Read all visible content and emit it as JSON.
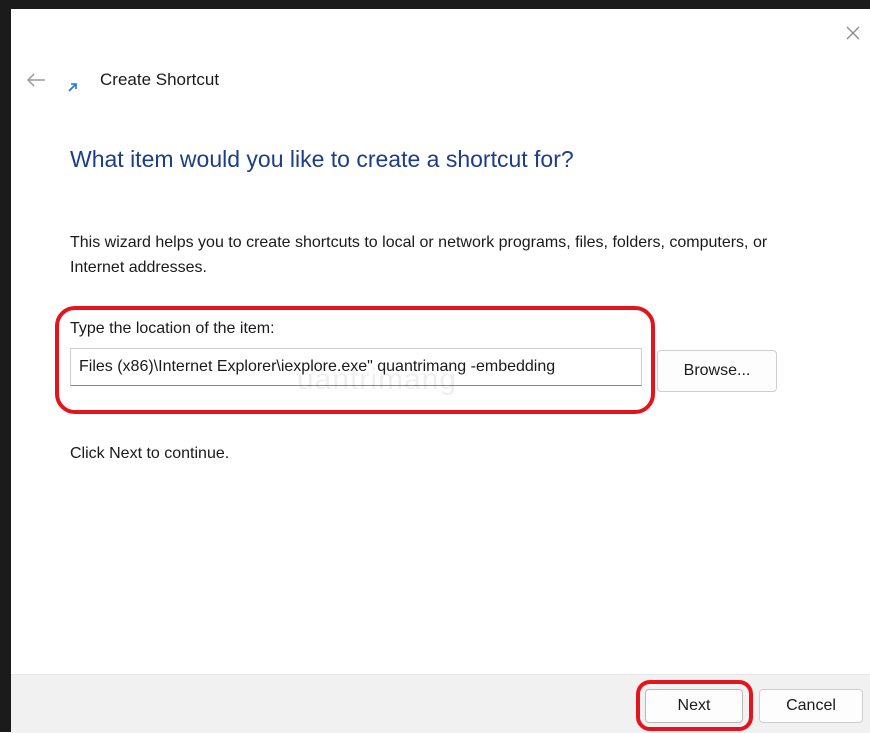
{
  "window": {
    "title": "Create Shortcut",
    "back_icon": "arrow-left-icon",
    "close_icon": "close-icon",
    "shortcut_icon": "shortcut-arrow-icon"
  },
  "main": {
    "heading": "What item would you like to create a shortcut for?",
    "description": "This wizard helps you to create shortcuts to local or network programs, files, folders, computers, or Internet addresses.",
    "location_label": "Type the location of the item:",
    "location_value": "Files (x86)\\Internet Explorer\\iexplore.exe\" quantrimang -embedding",
    "browse_label": "Browse...",
    "hint": "Click Next to continue.",
    "watermark": "uantrimang"
  },
  "footer": {
    "next_label": "Next",
    "cancel_label": "Cancel"
  },
  "colors": {
    "heading": "#1c3d8a",
    "highlight": "#e3141c",
    "footer_bg": "#f1f1f1"
  }
}
